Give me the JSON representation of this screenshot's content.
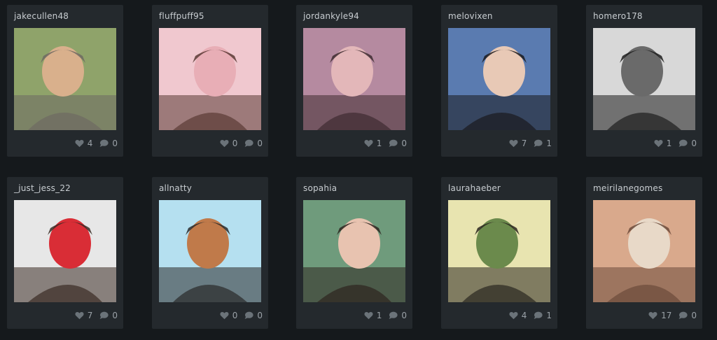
{
  "colors": {
    "background": "#15191c",
    "card": "#24292d",
    "username": "#c8cdd1",
    "stat": "#9aa1a7",
    "icon": "#6b7379"
  },
  "icons": {
    "like": "heart-icon",
    "comment": "comment-bubble-icon"
  },
  "posts": [
    {
      "username": "jakecullen48",
      "likes": "4",
      "comments": "0",
      "palette": [
        "#8fa36a",
        "#d9b08c",
        "#6e6a62"
      ]
    },
    {
      "username": "fluffpuff95",
      "likes": "0",
      "comments": "0",
      "palette": [
        "#f0c8cf",
        "#e8aeb6",
        "#5a3a35"
      ]
    },
    {
      "username": "jordankyle94",
      "likes": "1",
      "comments": "0",
      "palette": [
        "#b58aa0",
        "#e3b7b9",
        "#3e2b30"
      ]
    },
    {
      "username": "melovixen",
      "likes": "7",
      "comments": "1",
      "palette": [
        "#5a7bb0",
        "#e8c9b6",
        "#1a1a1e"
      ]
    },
    {
      "username": "homero178",
      "likes": "1",
      "comments": "0",
      "palette": [
        "#d8d8d8",
        "#6a6a6a",
        "#1e1e1e"
      ]
    },
    {
      "username": "_just_jess_22",
      "likes": "7",
      "comments": "0",
      "palette": [
        "#e7e7e7",
        "#d92d36",
        "#3a2b24"
      ]
    },
    {
      "username": "allnatty",
      "likes": "0",
      "comments": "0",
      "palette": [
        "#b5e0f0",
        "#c07a4a",
        "#2a2a2a"
      ]
    },
    {
      "username": "sopahia",
      "likes": "1",
      "comments": "0",
      "palette": [
        "#6f9b7c",
        "#e8c3b0",
        "#2d241f"
      ]
    },
    {
      "username": "laurahaeber",
      "likes": "4",
      "comments": "1",
      "palette": [
        "#e8e4b0",
        "#6b8a4c",
        "#2a2620"
      ]
    },
    {
      "username": "meirilanegomes",
      "likes": "17",
      "comments": "0",
      "palette": [
        "#d9a98c",
        "#e8d9c8",
        "#6b4a3a"
      ]
    }
  ]
}
